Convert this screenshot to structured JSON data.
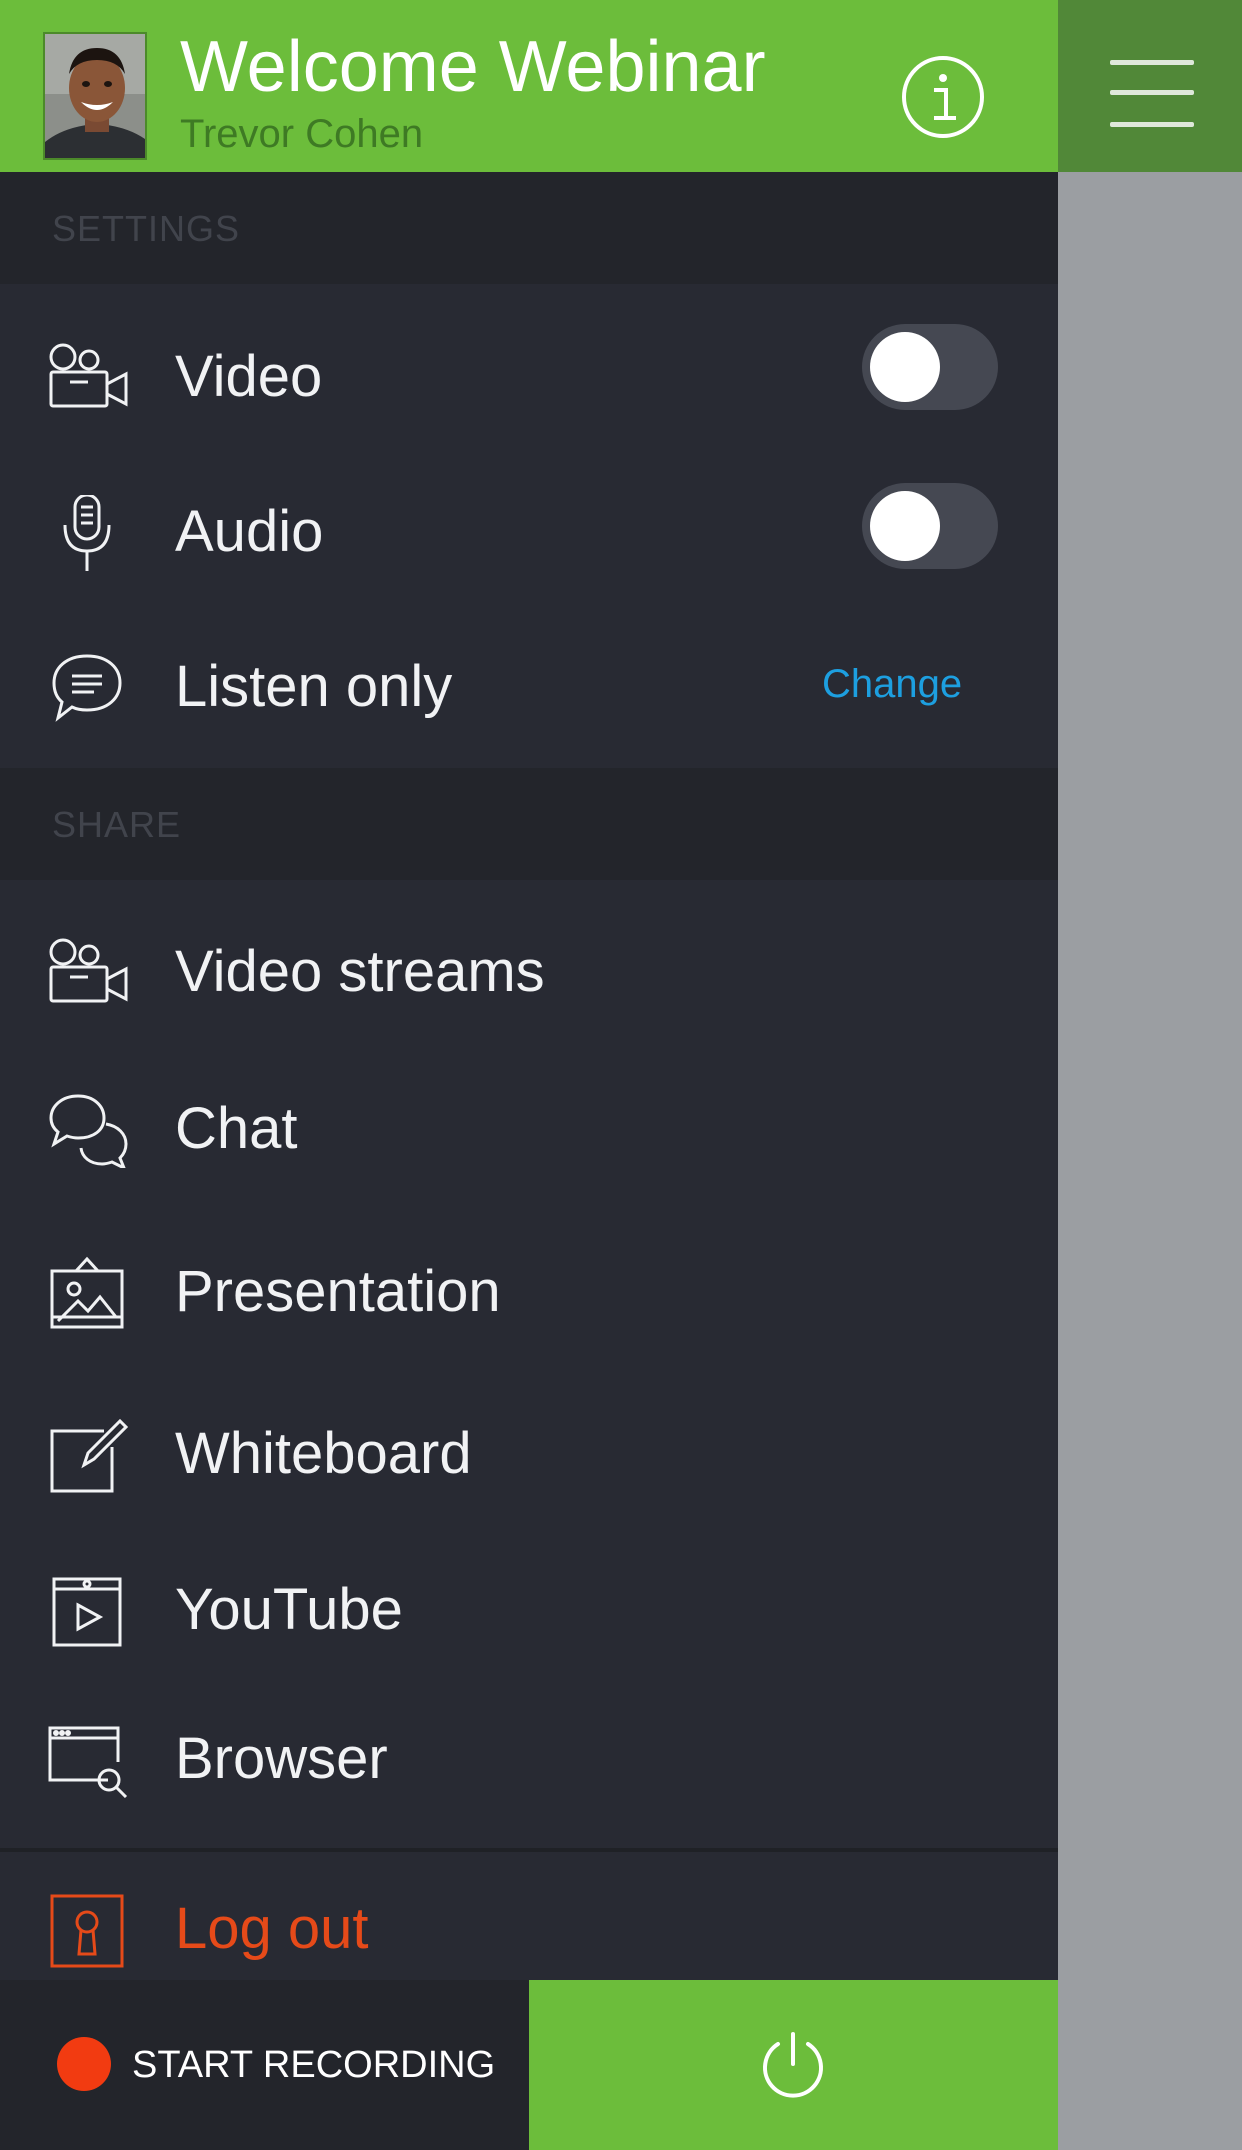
{
  "header": {
    "title": "Welcome Webinar",
    "subtitle": "Trevor Cohen",
    "info_icon": "info-icon",
    "menu_icon": "hamburger-menu-icon"
  },
  "settings": {
    "section_label": "SETTINGS",
    "items": [
      {
        "label": "Video",
        "icon": "video-camera-icon",
        "toggle_on": false
      },
      {
        "label": "Audio",
        "icon": "microphone-icon",
        "toggle_on": false
      },
      {
        "label": "Listen only",
        "icon": "speech-bubble-icon",
        "action": "Change"
      }
    ]
  },
  "share": {
    "section_label": "SHARE",
    "items": [
      {
        "label": "Video streams",
        "icon": "video-camera-icon"
      },
      {
        "label": "Chat",
        "icon": "chat-bubbles-icon"
      },
      {
        "label": "Presentation",
        "icon": "presentation-image-icon"
      },
      {
        "label": "Whiteboard",
        "icon": "whiteboard-pen-icon"
      },
      {
        "label": "YouTube",
        "icon": "youtube-play-icon"
      },
      {
        "label": "Browser",
        "icon": "browser-search-icon"
      }
    ]
  },
  "logout": {
    "label": "Log out",
    "icon": "logout-keyhole-icon"
  },
  "footer": {
    "record_label": "START RECORDING",
    "power_icon": "power-icon"
  },
  "colors": {
    "brand_green": "#6cbd3b",
    "dark_green": "#518838",
    "drawer_bg": "#282a33",
    "section_bg": "#23252b",
    "link_blue": "#1d9fe0",
    "logout_orange": "#e64a19",
    "record_red": "#f23b11"
  }
}
